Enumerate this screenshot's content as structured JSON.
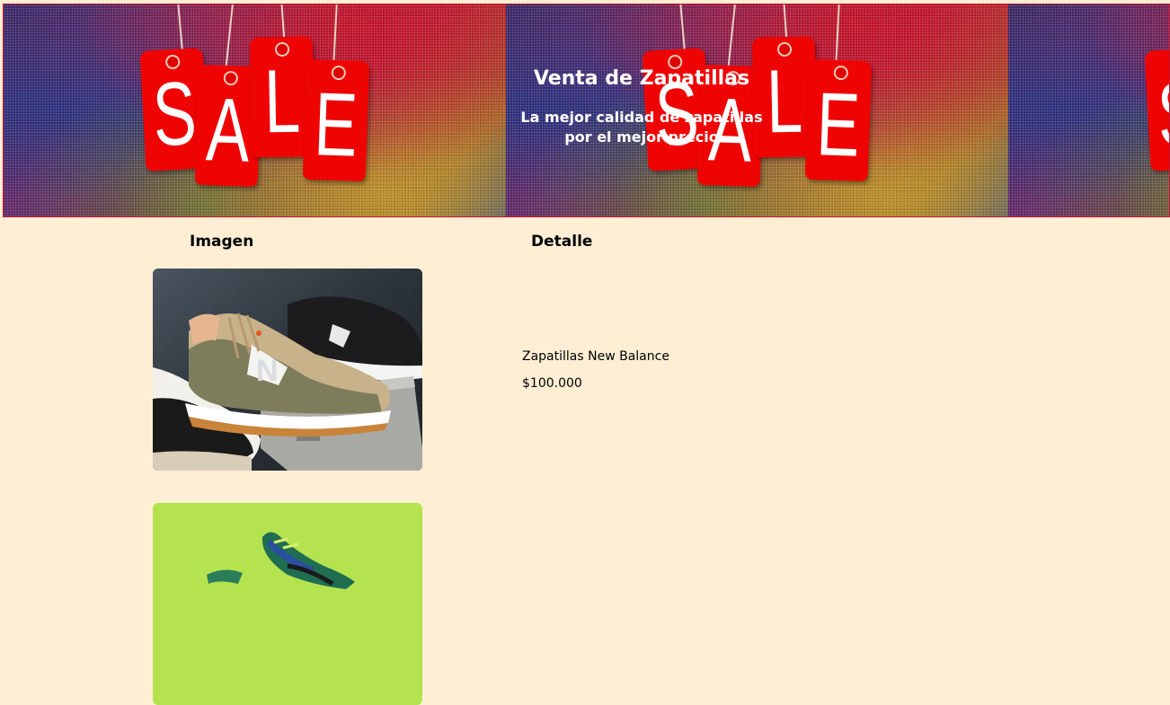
{
  "banner": {
    "title": "Venta de Zapatillas",
    "subtitle_line1": "La mejor calidad de zapatillas",
    "subtitle_line2": "por el mejor precio",
    "tag_letters": [
      "S",
      "A",
      "L",
      "E"
    ],
    "tag_color": "#ef0404"
  },
  "table": {
    "headers": {
      "image": "Imagen",
      "detail": "Detalle"
    },
    "products": [
      {
        "name": "Zapatillas New Balance",
        "price": "$100.000"
      },
      {
        "name": "",
        "price": ""
      }
    ]
  },
  "colors": {
    "page_background": "#feefd4",
    "banner_border": "#c8102e"
  }
}
